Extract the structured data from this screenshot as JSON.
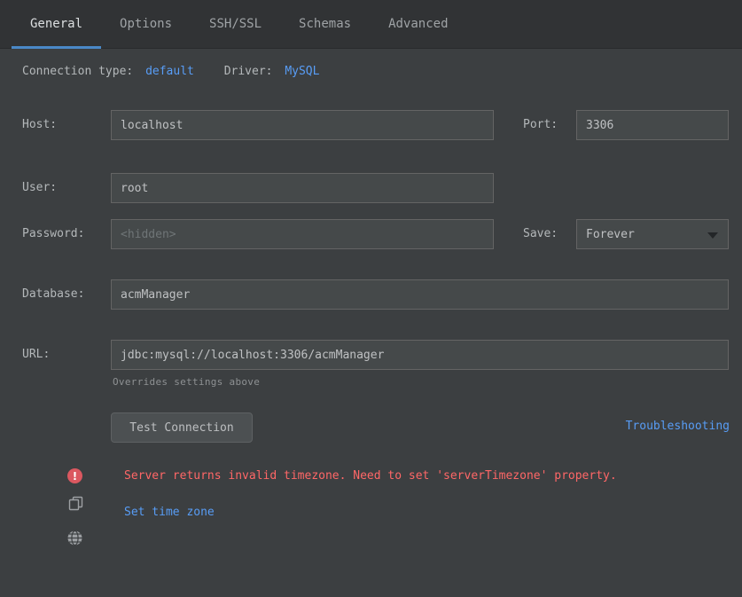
{
  "tabs": [
    {
      "label": "General",
      "active": true
    },
    {
      "label": "Options",
      "active": false
    },
    {
      "label": "SSH/SSL",
      "active": false
    },
    {
      "label": "Schemas",
      "active": false
    },
    {
      "label": "Advanced",
      "active": false
    }
  ],
  "header": {
    "connection_type_label": "Connection type:",
    "connection_type_value": "default",
    "driver_label": "Driver:",
    "driver_value": "MySQL"
  },
  "form": {
    "host_label": "Host:",
    "host_value": "localhost",
    "port_label": "Port:",
    "port_value": "3306",
    "user_label": "User:",
    "user_value": "root",
    "password_label": "Password:",
    "password_placeholder": "<hidden>",
    "save_label": "Save:",
    "save_value": "Forever",
    "database_label": "Database:",
    "database_value": "acmManager",
    "url_label": "URL:",
    "url_value": "jdbc:mysql://localhost:3306/acmManager",
    "url_hint": "Overrides settings above"
  },
  "actions": {
    "test_connection_label": "Test Connection",
    "troubleshooting_label": "Troubleshooting"
  },
  "error": {
    "message": "Server returns invalid timezone. Need to set 'serverTimezone' property.",
    "set_time_zone_label": "Set time zone"
  },
  "icons": {
    "error": "error-icon",
    "copy": "copy-icon",
    "web": "web-icon",
    "chevron": "chevron-down-icon"
  },
  "colors": {
    "link": "#589df6",
    "error": "#ff6767",
    "tab_underline": "#4a88c7"
  }
}
